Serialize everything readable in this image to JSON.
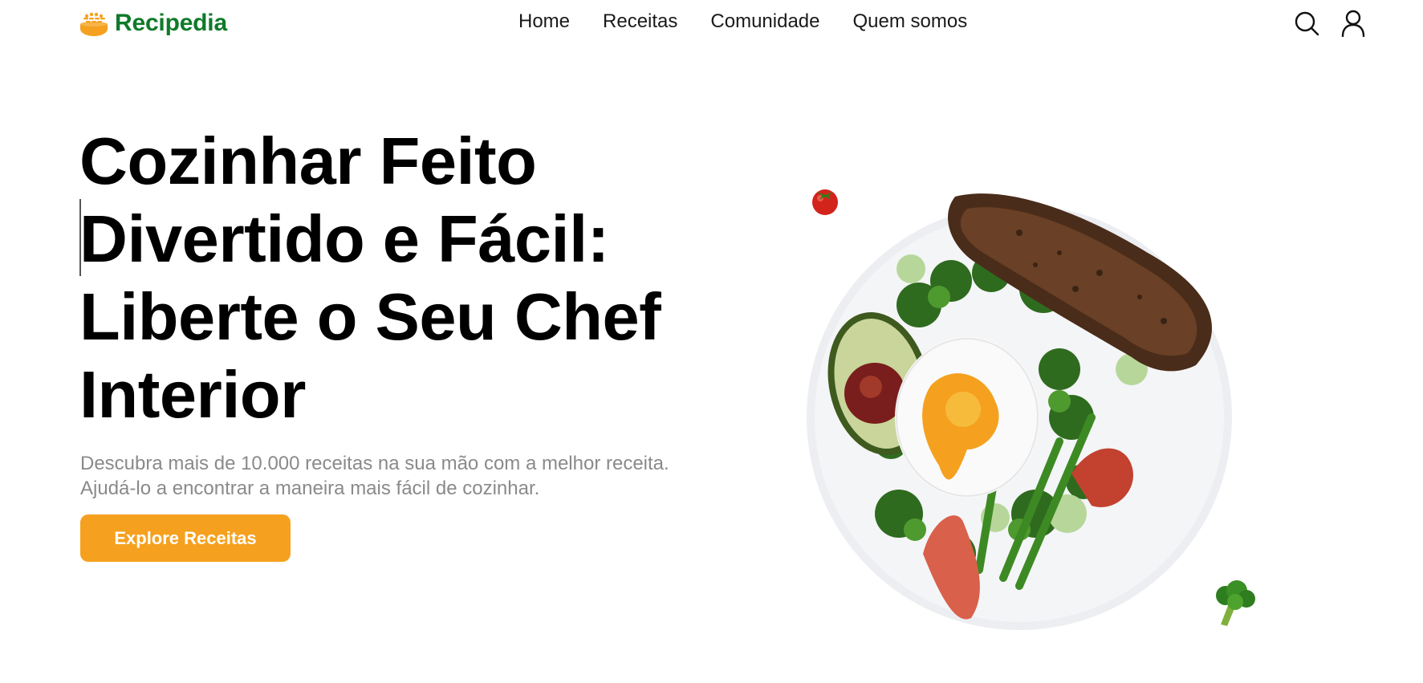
{
  "brand": {
    "name": "Recipedia",
    "logo_icon": "bread-basket-icon",
    "color": "#0f7a2a"
  },
  "nav": {
    "items": [
      {
        "label": "Home"
      },
      {
        "label": "Receitas"
      },
      {
        "label": "Comunidade"
      },
      {
        "label": "Quem somos"
      }
    ],
    "icons": [
      "search-icon",
      "user-icon"
    ]
  },
  "hero": {
    "title": "Cozinhar Feito Divertido e Fácil: Liberte o Seu Chef Interior",
    "description": "Descubra mais de 10.000 receitas na sua mão com a melhor receita. Ajudá-lo a encontrar a maneira mais fácil de cozinhar.",
    "cta_label": "Explore Receitas",
    "cta_color": "#f5a11f",
    "image": "plate-with-egg-avocado-bread-salad",
    "decorations": [
      "tomato-icon",
      "broccoli-icon"
    ]
  }
}
